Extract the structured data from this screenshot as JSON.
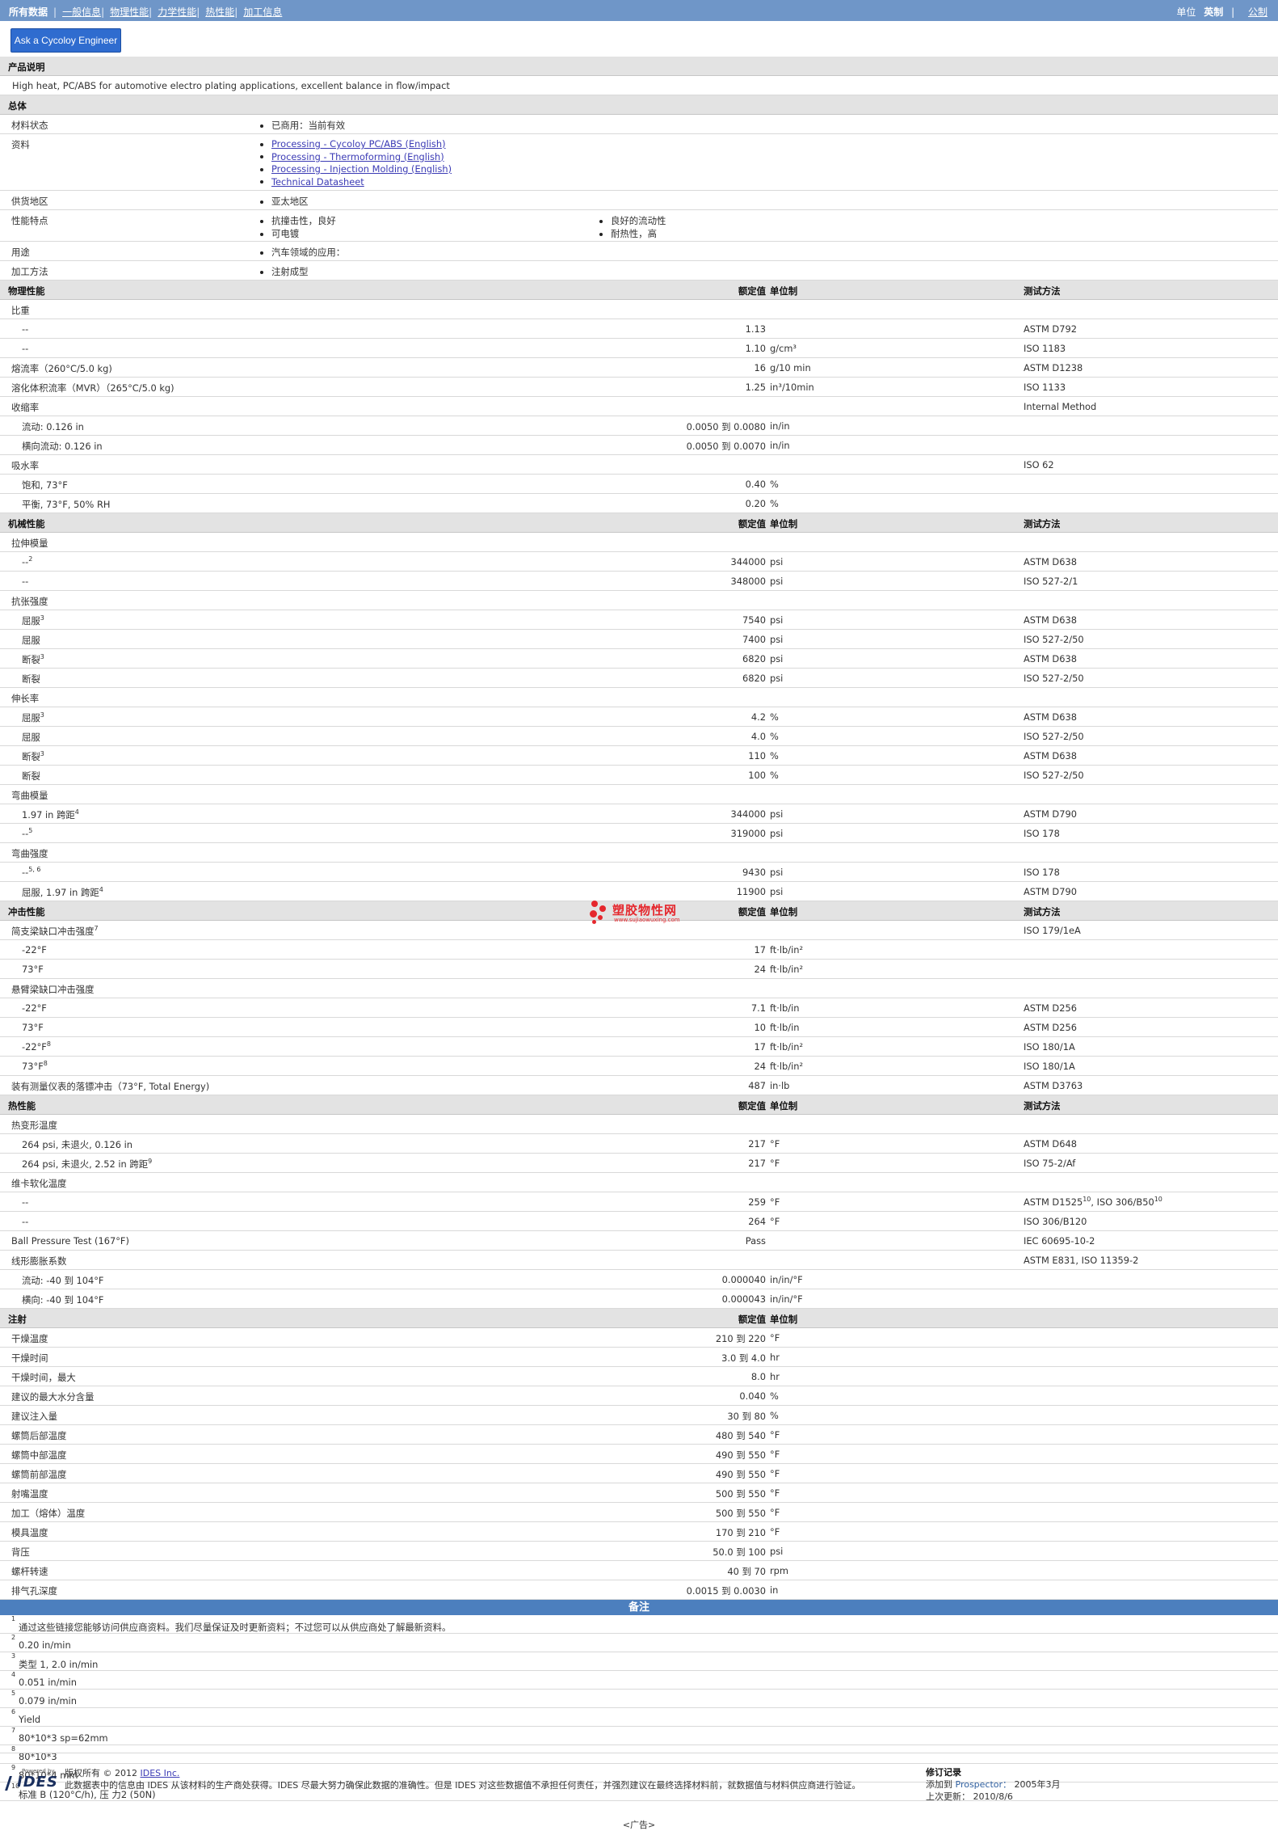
{
  "nav": {
    "items": [
      "所有数据",
      "一般信息",
      "物理性能",
      "力学性能",
      "热性能",
      "加工信息"
    ],
    "units_label": "单位",
    "units_en": "英制",
    "units_metric": "公制"
  },
  "ask_button": "Ask a Cycoloy Engineer",
  "description": {
    "title": "产品说明",
    "text": "High heat, PC/ABS for automotive electro plating applications, excellent balance in flow/impact"
  },
  "general": {
    "title": "总体",
    "material_status_label": "材料状态",
    "material_status": "已商用：当前有效",
    "resources_label": "资料",
    "resources_sup": "1",
    "resources": [
      "Processing - Cycoloy PC/ABS (English)",
      "Processing - Thermoforming (English)",
      "Processing - Injection Molding (English)",
      "Technical Datasheet"
    ],
    "region_label": "供货地区",
    "region": "亚太地区",
    "features_label": "性能特点",
    "features_col1": [
      "抗撞击性，良好",
      "可电镀"
    ],
    "features_col2": [
      "良好的流动性",
      "耐热性，高"
    ],
    "uses_label": "用途",
    "uses": "汽车领域的应用：",
    "method_label": "加工方法",
    "method": "注射成型"
  },
  "headers": {
    "nominal": "额定值",
    "unit": "单位制",
    "test": "测试方法"
  },
  "sections": [
    {
      "title": "物理性能",
      "rows": [
        {
          "label": "比重"
        },
        {
          "label": "--",
          "i": 1,
          "v": "1.13",
          "u": "",
          "t": "ASTM D792"
        },
        {
          "label": "--",
          "i": 1,
          "v": "1.10",
          "u": "g/cm³",
          "t": "ISO 1183"
        },
        {
          "label": "熔流率（260°C/5.0 kg)",
          "v": "16",
          "u": "g/10 min",
          "t": "ASTM D1238"
        },
        {
          "label": "溶化体积流率（MVR）（265°C/5.0 kg)",
          "v": "1.25",
          "u": "in³/10min",
          "t": "ISO 1133"
        },
        {
          "label": "收缩率",
          "t": "Internal Method"
        },
        {
          "label": "流动: 0.126 in",
          "i": 1,
          "v": "0.0050 到  0.0080",
          "u": "in/in"
        },
        {
          "label": "横向流动: 0.126 in",
          "i": 1,
          "v": "0.0050 到  0.0070",
          "u": "in/in"
        },
        {
          "label": "吸水率",
          "t": "ISO 62"
        },
        {
          "label": "饱和, 73°F",
          "i": 1,
          "v": "0.40",
          "u": "%"
        },
        {
          "label": "平衡, 73°F, 50% RH",
          "i": 1,
          "v": "0.20",
          "u": "%"
        }
      ]
    },
    {
      "title": "机械性能",
      "rows": [
        {
          "label": "拉伸模量"
        },
        {
          "label": "--",
          "sup": "2",
          "i": 1,
          "v": "344000",
          "u": "psi",
          "t": "ASTM D638"
        },
        {
          "label": "--",
          "i": 1,
          "v": "348000",
          "u": "psi",
          "t": "ISO 527-2/1"
        },
        {
          "label": "抗张强度"
        },
        {
          "label": "屈服",
          "sup": "3",
          "i": 1,
          "v": "7540",
          "u": "psi",
          "t": "ASTM D638"
        },
        {
          "label": "屈服",
          "i": 1,
          "v": "7400",
          "u": "psi",
          "t": "ISO 527-2/50"
        },
        {
          "label": "断裂",
          "sup": "3",
          "i": 1,
          "v": "6820",
          "u": "psi",
          "t": "ASTM D638"
        },
        {
          "label": "断裂",
          "i": 1,
          "v": "6820",
          "u": "psi",
          "t": "ISO 527-2/50"
        },
        {
          "label": "伸长率"
        },
        {
          "label": "屈服",
          "sup": "3",
          "i": 1,
          "v": "4.2",
          "u": "%",
          "t": "ASTM D638"
        },
        {
          "label": "屈服",
          "i": 1,
          "v": "4.0",
          "u": "%",
          "t": "ISO 527-2/50"
        },
        {
          "label": "断裂",
          "sup": "3",
          "i": 1,
          "v": "110",
          "u": "%",
          "t": "ASTM D638"
        },
        {
          "label": "断裂",
          "i": 1,
          "v": "100",
          "u": "%",
          "t": "ISO 527-2/50"
        },
        {
          "label": "弯曲模量"
        },
        {
          "label": "1.97 in 跨距",
          "sup": "4",
          "i": 1,
          "v": "344000",
          "u": "psi",
          "t": "ASTM D790"
        },
        {
          "label": "--",
          "sup": "5",
          "i": 1,
          "v": "319000",
          "u": "psi",
          "t": "ISO 178"
        },
        {
          "label": "弯曲强度"
        },
        {
          "label": "--",
          "sup": "5, 6",
          "i": 1,
          "v": "9430",
          "u": "psi",
          "t": "ISO 178"
        },
        {
          "label": "屈服, 1.97 in 跨距",
          "sup": "4",
          "i": 1,
          "v": "11900",
          "u": "psi",
          "t": "ASTM D790"
        }
      ]
    },
    {
      "title": "冲击性能",
      "rows": [
        {
          "label": "简支梁缺口冲击强度",
          "sup": "7",
          "t": "ISO 179/1eA"
        },
        {
          "label": "-22°F",
          "i": 1,
          "v": "17",
          "u": "ft·lb/in²"
        },
        {
          "label": "73°F",
          "i": 1,
          "v": "24",
          "u": "ft·lb/in²"
        },
        {
          "label": "悬臂梁缺口冲击强度"
        },
        {
          "label": "-22°F",
          "i": 1,
          "v": "7.1",
          "u": "ft·lb/in",
          "t": "ASTM D256"
        },
        {
          "label": "73°F",
          "i": 1,
          "v": "10",
          "u": "ft·lb/in",
          "t": "ASTM D256"
        },
        {
          "label": "-22°F",
          "sup": "8",
          "i": 1,
          "v": "17",
          "u": "ft·lb/in²",
          "t": "ISO 180/1A"
        },
        {
          "label": "73°F",
          "sup": "8",
          "i": 1,
          "v": "24",
          "u": "ft·lb/in²",
          "t": "ISO 180/1A"
        },
        {
          "label": "装有测量仪表的落镖冲击（73°F, Total Energy)",
          "v": "487",
          "u": "in·lb",
          "t": "ASTM D3763"
        }
      ]
    },
    {
      "title": "热性能",
      "rows": [
        {
          "label": "热变形温度"
        },
        {
          "label": "264 psi, 未退火, 0.126 in",
          "i": 1,
          "v": "217",
          "u": "°F",
          "t": "ASTM D648"
        },
        {
          "label": "264 psi, 未退火, 2.52 in 跨距",
          "sup": "9",
          "i": 1,
          "v": "217",
          "u": "°F",
          "t": "ISO 75-2/Af"
        },
        {
          "label": "维卡软化温度"
        },
        {
          "label": "--",
          "i": 1,
          "v": "259",
          "u": "°F",
          "t": "ASTM D1525",
          "tsup": "10",
          "t2": ", ISO 306/B50",
          "t2sup": "10"
        },
        {
          "label": "--",
          "i": 1,
          "v": "264",
          "u": "°F",
          "t": "ISO 306/B120"
        },
        {
          "label": "Ball Pressure Test (167°F)",
          "v": "Pass",
          "u": "",
          "t": "IEC 60695-10-2"
        },
        {
          "label": "线形膨胀系数",
          "t": "ASTM E831, ISO 11359-2"
        },
        {
          "label": "流动: -40 到  104°F",
          "i": 1,
          "v": "0.000040",
          "u": "in/in/°F"
        },
        {
          "label": "横向: -40 到  104°F",
          "i": 1,
          "v": "0.000043",
          "u": "in/in/°F"
        }
      ]
    },
    {
      "title": "注射",
      "notest": true,
      "rows": [
        {
          "label": "干燥温度",
          "v": "210 到  220",
          "u": "°F"
        },
        {
          "label": "干燥时间",
          "v": "3.0 到  4.0",
          "u": "hr"
        },
        {
          "label": "干燥时间，最大",
          "v": "8.0",
          "u": "hr"
        },
        {
          "label": "建议的最大水分含量",
          "v": "0.040",
          "u": "%"
        },
        {
          "label": "建议注入量",
          "v": "30 到  80",
          "u": "%"
        },
        {
          "label": "螺筒后部温度",
          "v": "480 到  540",
          "u": "°F"
        },
        {
          "label": "螺筒中部温度",
          "v": "490 到  550",
          "u": "°F"
        },
        {
          "label": "螺筒前部温度",
          "v": "490 到  550",
          "u": "°F"
        },
        {
          "label": "射嘴温度",
          "v": "500 到  550",
          "u": "°F"
        },
        {
          "label": "加工（熔体）温度",
          "v": "500 到  550",
          "u": "°F"
        },
        {
          "label": "模具温度",
          "v": "170 到  210",
          "u": "°F"
        },
        {
          "label": "背压",
          "v": "50.0 到  100",
          "u": "psi"
        },
        {
          "label": "螺杆转速",
          "v": "40 到  70",
          "u": "rpm"
        },
        {
          "label": "排气孔深度",
          "v": "0.0015 到  0.0030",
          "u": "in"
        }
      ]
    }
  ],
  "notes": {
    "title": "备注",
    "items": [
      {
        "n": "1",
        "text": "通过这些链接您能够访问供应商资料。我们尽量保证及时更新资料；不过您可以从供应商处了解最新资料。"
      },
      {
        "n": "2",
        "text": "0.20 in/min"
      },
      {
        "n": "3",
        "text": "类型  1, 2.0 in/min"
      },
      {
        "n": "4",
        "text": "0.051 in/min"
      },
      {
        "n": "5",
        "text": "0.079 in/min"
      },
      {
        "n": "6",
        "text": "Yield"
      },
      {
        "n": "7",
        "text": "80*10*3 sp=62mm"
      },
      {
        "n": "8",
        "text": "80*10*3"
      },
      {
        "n": "9",
        "text": "80*10*4 mm"
      },
      {
        "n": "10",
        "text": "标准  B (120°C/h), 压  力2 (50N)"
      }
    ]
  },
  "footer": {
    "powered_by": "Powered by",
    "logo_text": "IDES",
    "copyright": "版权所有 © 2012",
    "copyright_link": "IDES Inc.",
    "disclaimer": "此数据表中的信息由 IDES 从该材料的生产商处获得。IDES 尽最大努力确保此数据的准确性。但是 IDES 对这些数据值不承担任何责任，并强烈建议在最终选择材料前，就数据值与材料供应商进行验证。",
    "rev_title": "修订记录",
    "added_label": "添加到",
    "added_app": "Prospector：",
    "added_date": "2005年3月",
    "updated_label": "上次更新：",
    "updated_date": "2010/8/6",
    "ad": "<广告>"
  },
  "watermark": {
    "cn": "塑胶物性网",
    "en": "www.sujiaowuxing.com"
  }
}
